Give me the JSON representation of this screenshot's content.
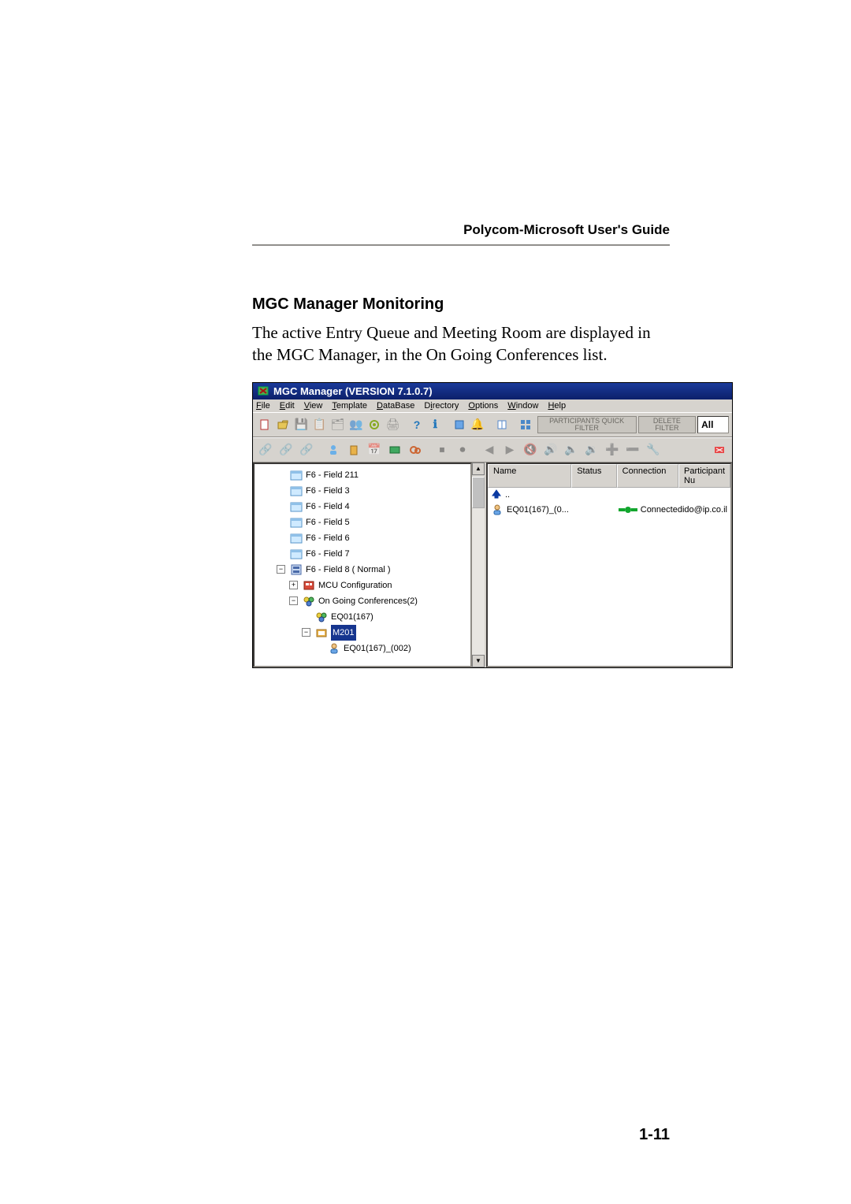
{
  "doc": {
    "header": "Polycom-Microsoft User's Guide",
    "section_heading": "MGC Manager Monitoring",
    "body_text": "The active Entry Queue and Meeting Room are displayed in the MGC Manager, in the On Going Conferences list.",
    "page_number": "1-11"
  },
  "app": {
    "title": "MGC Manager (VERSION 7.1.0.7)",
    "menu": {
      "file": "File",
      "edit": "Edit",
      "view": "View",
      "template": "Template",
      "database": "DataBase",
      "directory": "Directory",
      "options": "Options",
      "window": "Window",
      "help": "Help"
    },
    "filter_buttons": {
      "participants": "PARTICIPANTS QUICK FILTER",
      "delete_filter": "DELETE FILTER"
    },
    "filter_value": "All",
    "tree": {
      "items": [
        {
          "label": "F6 - Field 211",
          "indent": 1,
          "icon": "folder"
        },
        {
          "label": "F6 - Field 3",
          "indent": 1,
          "icon": "folder"
        },
        {
          "label": "F6 - Field 4",
          "indent": 1,
          "icon": "folder"
        },
        {
          "label": "F6 - Field 5",
          "indent": 1,
          "icon": "folder"
        },
        {
          "label": "F6 - Field 6",
          "indent": 1,
          "icon": "folder"
        },
        {
          "label": "F6 - Field 7",
          "indent": 1,
          "icon": "folder"
        },
        {
          "label": "F6 - Field 8   ( Normal )",
          "indent": 1,
          "icon": "server",
          "expander": "-"
        },
        {
          "label": "MCU Configuration",
          "indent": 2,
          "icon": "mcu",
          "expander": "+"
        },
        {
          "label": "On Going Conferences(2)",
          "indent": 2,
          "icon": "queue",
          "expander": "-"
        },
        {
          "label": "EQ01(167)",
          "indent": 3,
          "icon": "queue"
        },
        {
          "label": "M201",
          "indent": 3,
          "icon": "mr",
          "expander": "-",
          "selected": true
        },
        {
          "label": "EQ01(167)_(002)",
          "indent": 4,
          "icon": "part"
        }
      ]
    },
    "list": {
      "columns": {
        "name": "Name",
        "status": "Status",
        "connection": "Connection",
        "participant_nu": "Participant Nu"
      },
      "row_up": "..",
      "rows": [
        {
          "name": "EQ01(167)_(0...",
          "status": "",
          "connection": "Connected",
          "participant": "ido@ip.co.il"
        }
      ]
    }
  }
}
